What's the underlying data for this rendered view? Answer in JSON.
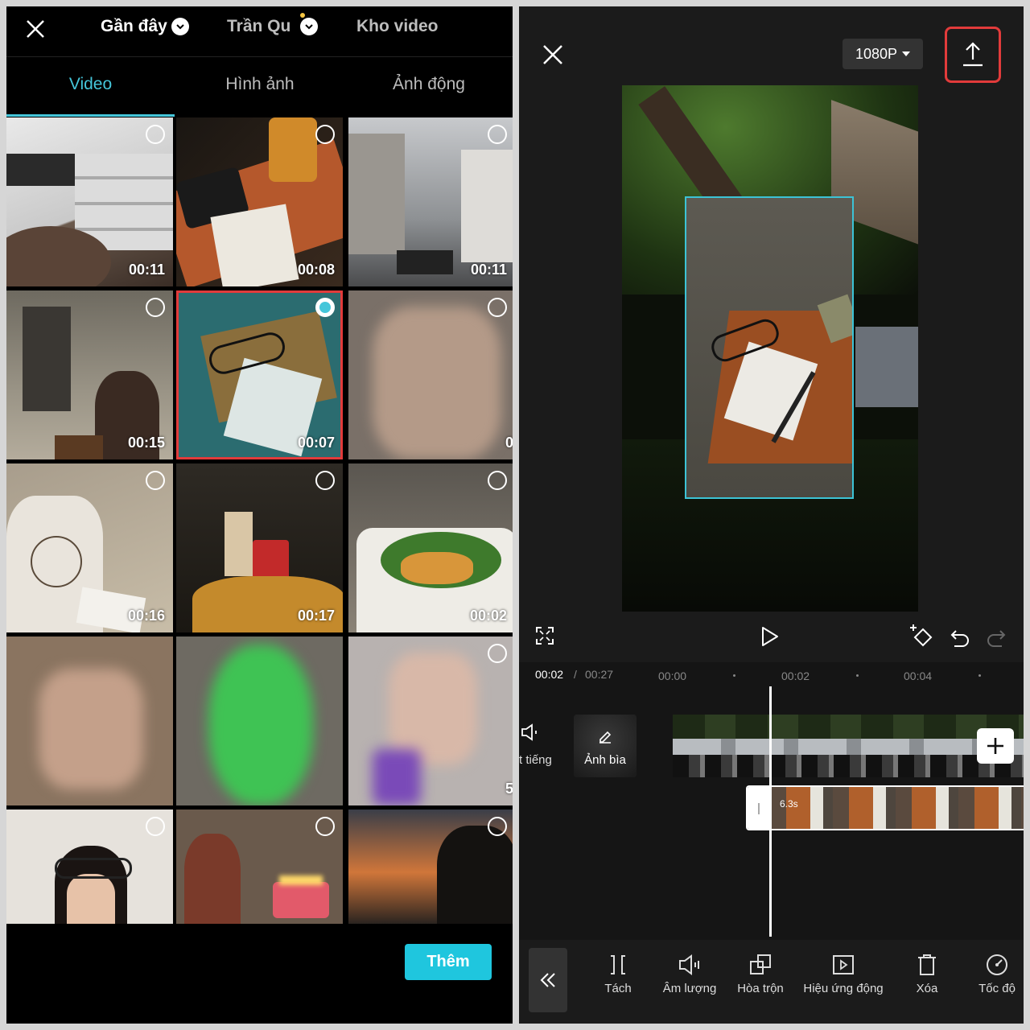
{
  "picker": {
    "sources": [
      "Gần đây",
      "Trần Qu",
      "Kho video"
    ],
    "tabs": [
      "Video",
      "Hình ảnh",
      "Ảnh động"
    ],
    "durations": [
      "00:11",
      "00:08",
      "00:11",
      "00:15",
      "00:07",
      "00:16",
      "00:17",
      "00:02"
    ],
    "partial_durations": [
      "0",
      "5"
    ],
    "add_label": "Thêm"
  },
  "editor": {
    "resolution": "1080P",
    "time_current": "00:02",
    "time_separator": "/",
    "time_total": "00:27",
    "ruler": [
      "00:00",
      "00:02",
      "00:04"
    ],
    "audio_label": "t tiếng",
    "cover_label": "Ảnh bìa",
    "clip_duration": "6.3s",
    "tools": [
      "Tách",
      "Âm lượng",
      "Hòa trộn",
      "Hiệu ứng động",
      "Xóa",
      "Tốc độ"
    ]
  },
  "colors": {
    "accent": "#45c6da",
    "highlight": "#e23b3b",
    "add_button": "#1fc6de"
  }
}
